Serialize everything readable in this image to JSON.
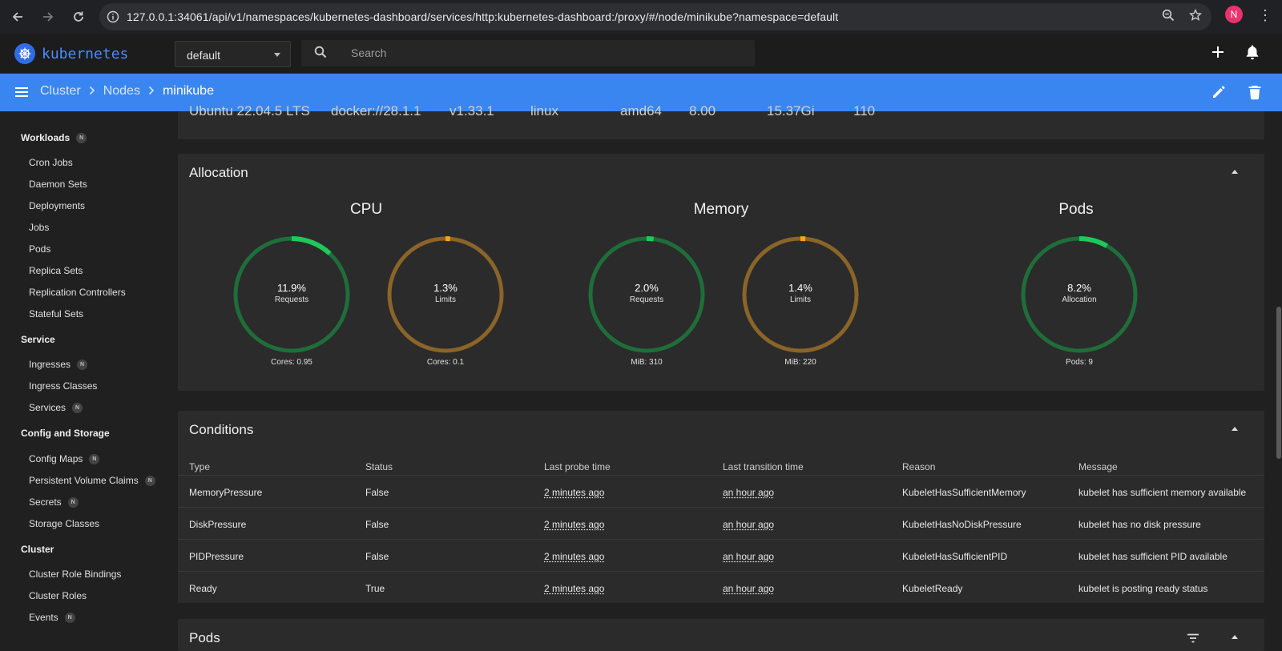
{
  "browser": {
    "url": "127.0.0.1:34061/api/v1/namespaces/kubernetes-dashboard/services/http:kubernetes-dashboard:/proxy/#/node/minikube?namespace=default",
    "profile_initial": "N"
  },
  "app": {
    "logo_text": "kubernetes",
    "namespace": "default",
    "search_placeholder": "Search"
  },
  "breadcrumb": [
    "Cluster",
    "Nodes",
    "minikube"
  ],
  "sidebar": {
    "sections": [
      {
        "title": "Workloads",
        "badge": "N",
        "items": [
          {
            "label": "Cron Jobs"
          },
          {
            "label": "Daemon Sets"
          },
          {
            "label": "Deployments"
          },
          {
            "label": "Jobs"
          },
          {
            "label": "Pods"
          },
          {
            "label": "Replica Sets"
          },
          {
            "label": "Replication Controllers"
          },
          {
            "label": "Stateful Sets"
          }
        ]
      },
      {
        "title": "Service",
        "items": [
          {
            "label": "Ingresses",
            "badge": "N"
          },
          {
            "label": "Ingress Classes"
          },
          {
            "label": "Services",
            "badge": "N"
          }
        ]
      },
      {
        "title": "Config and Storage",
        "items": [
          {
            "label": "Config Maps",
            "badge": "N"
          },
          {
            "label": "Persistent Volume Claims",
            "badge": "N"
          },
          {
            "label": "Secrets",
            "badge": "N"
          },
          {
            "label": "Storage Classes"
          }
        ]
      },
      {
        "title": "Cluster",
        "items": [
          {
            "label": "Cluster Role Bindings"
          },
          {
            "label": "Cluster Roles"
          },
          {
            "label": "Events",
            "badge": "N"
          }
        ]
      }
    ]
  },
  "system_info": [
    "Ubuntu 22.04.5 LTS",
    "docker://28.1.1",
    "v1.33.1",
    "linux",
    "amd64",
    "8.00",
    "15.37Gi",
    "110"
  ],
  "allocation": {
    "title": "Allocation",
    "groups": [
      {
        "title": "CPU",
        "gauges": [
          {
            "percent": "11.9%",
            "value": 0.119,
            "label": "Requests",
            "footer": "Cores: 0.95",
            "kind": "requests"
          },
          {
            "percent": "1.3%",
            "value": 0.013,
            "label": "Limits",
            "footer": "Cores: 0.1",
            "kind": "limits"
          }
        ]
      },
      {
        "title": "Memory",
        "gauges": [
          {
            "percent": "2.0%",
            "value": 0.02,
            "label": "Requests",
            "footer": "MiB: 310",
            "kind": "requests"
          },
          {
            "percent": "1.4%",
            "value": 0.014,
            "label": "Limits",
            "footer": "MiB: 220",
            "kind": "limits"
          }
        ]
      },
      {
        "title": "Pods",
        "gauges": [
          {
            "percent": "8.2%",
            "value": 0.082,
            "label": "Allocation",
            "footer": "Pods: 9",
            "kind": "requests"
          }
        ]
      }
    ],
    "colors": {
      "requests_track": "#1f6e3a",
      "requests_fill": "#1ec95a",
      "limits_track": "#8a6428",
      "limits_fill": "#f2a422"
    }
  },
  "conditions": {
    "title": "Conditions",
    "columns": [
      "Type",
      "Status",
      "Last probe time",
      "Last transition time",
      "Reason",
      "Message"
    ],
    "rows": [
      [
        "MemoryPressure",
        "False",
        "2 minutes ago",
        "an hour ago",
        "KubeletHasSufficientMemory",
        "kubelet has sufficient memory available"
      ],
      [
        "DiskPressure",
        "False",
        "2 minutes ago",
        "an hour ago",
        "KubeletHasNoDiskPressure",
        "kubelet has no disk pressure"
      ],
      [
        "PIDPressure",
        "False",
        "2 minutes ago",
        "an hour ago",
        "KubeletHasSufficientPID",
        "kubelet has sufficient PID available"
      ],
      [
        "Ready",
        "True",
        "2 minutes ago",
        "an hour ago",
        "KubeletReady",
        "kubelet is posting ready status"
      ]
    ]
  },
  "pods_card": {
    "title": "Pods"
  }
}
